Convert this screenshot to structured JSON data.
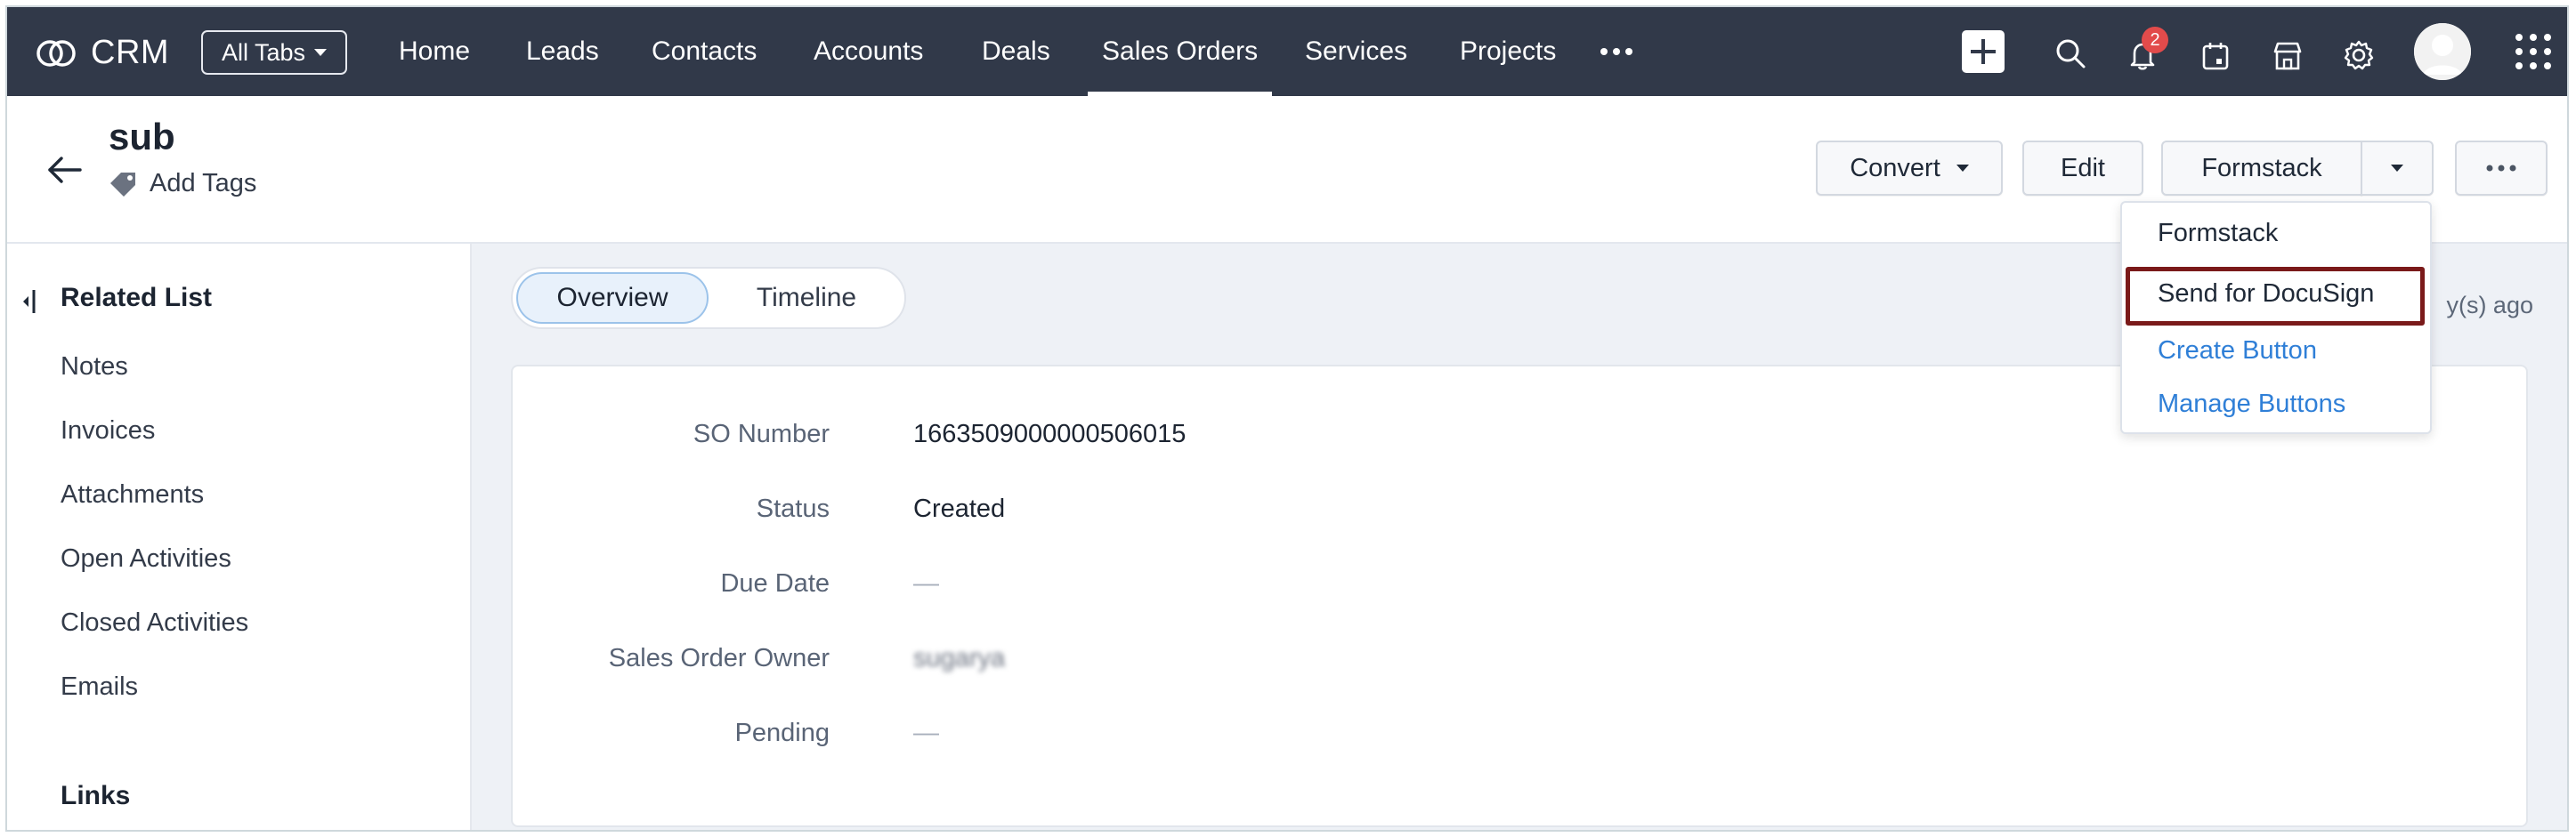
{
  "topnav": {
    "app_name": "CRM",
    "all_tabs_label": "All Tabs",
    "links": [
      "Home",
      "Leads",
      "Contacts",
      "Accounts",
      "Deals",
      "Sales Orders",
      "Services",
      "Projects"
    ],
    "active_link": "Sales Orders",
    "notification_count": "2",
    "icons": [
      "more-icon",
      "plus-icon",
      "search-icon",
      "bell-icon",
      "calendar-icon",
      "marketplace-icon",
      "gear-icon",
      "avatar",
      "apps-grid-icon"
    ]
  },
  "header": {
    "title": "sub",
    "add_tags_label": "Add Tags",
    "convert_label": "Convert",
    "edit_label": "Edit",
    "formstack_label": "Formstack"
  },
  "dropdown": {
    "items": [
      "Formstack",
      "Send for DocuSign",
      "Create Button",
      "Manage Buttons"
    ],
    "highlighted": "Send for DocuSign"
  },
  "sidebar": {
    "title": "Related List",
    "items": [
      "Notes",
      "Invoices",
      "Attachments",
      "Open Activities",
      "Closed Activities",
      "Emails"
    ],
    "links_title": "Links"
  },
  "main": {
    "tabs": [
      "Overview",
      "Timeline"
    ],
    "active_tab": "Overview",
    "modified_suffix": "y(s) ago",
    "fields": [
      {
        "label": "SO Number",
        "value": "1663509000000506015"
      },
      {
        "label": "Status",
        "value": "Created"
      },
      {
        "label": "Due Date",
        "value": "—"
      },
      {
        "label": "Sales Order Owner",
        "value": "sugarya"
      },
      {
        "label": "Pending",
        "value": "—"
      }
    ]
  },
  "colors": {
    "nav_bg": "#313949",
    "link_blue": "#2f7fd7",
    "highlight_border": "#7a1a1a",
    "badge_red": "#e24b4b",
    "main_bg": "#eef1f6"
  }
}
